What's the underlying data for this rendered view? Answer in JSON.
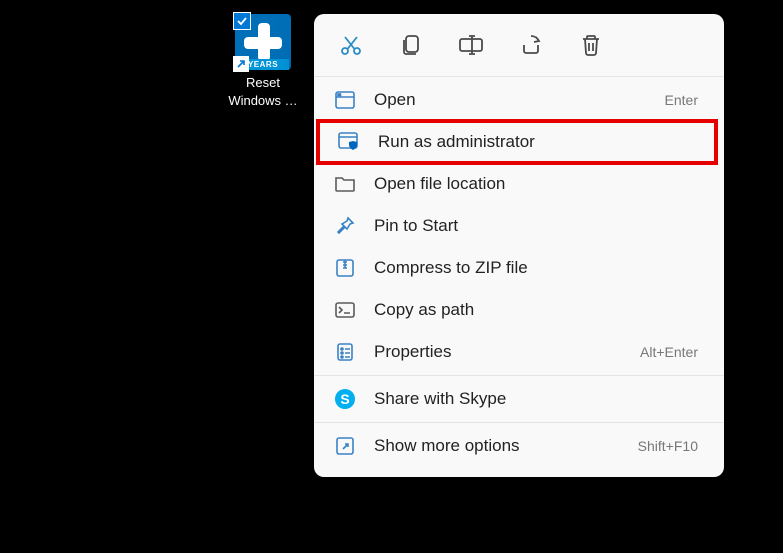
{
  "shortcut": {
    "label_line1": "Reset",
    "label_line2": "Windows …",
    "years_badge": "YEARS"
  },
  "context_menu": {
    "actions": {
      "cut": "cut-icon",
      "copy": "copy-icon",
      "rename": "rename-icon",
      "share": "share-icon",
      "delete": "delete-icon"
    },
    "items": [
      {
        "icon": "app-window-icon",
        "label": "Open",
        "hotkey": "Enter"
      },
      {
        "icon": "shield-icon",
        "label": "Run as administrator",
        "hotkey": "",
        "highlighted": true
      },
      {
        "icon": "folder-icon",
        "label": "Open file location",
        "hotkey": ""
      },
      {
        "icon": "pin-icon",
        "label": "Pin to Start",
        "hotkey": ""
      },
      {
        "icon": "zip-icon",
        "label": "Compress to ZIP file",
        "hotkey": ""
      },
      {
        "icon": "path-icon",
        "label": "Copy as path",
        "hotkey": ""
      },
      {
        "icon": "properties-icon",
        "label": "Properties",
        "hotkey": "Alt+Enter"
      }
    ],
    "share_item": {
      "icon": "skype-icon",
      "label": "Share with Skype",
      "hotkey": ""
    },
    "more_item": {
      "icon": "more-options-icon",
      "label": "Show more options",
      "hotkey": "Shift+F10"
    }
  }
}
